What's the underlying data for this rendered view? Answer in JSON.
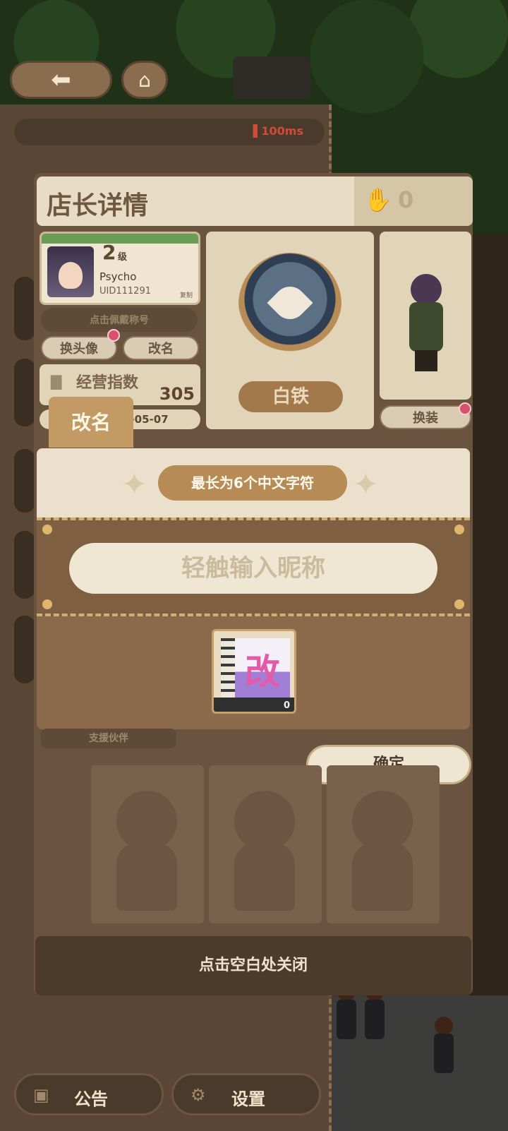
{
  "status": {
    "ping": "100ms"
  },
  "profile": {
    "title": "店长详情",
    "likes": "0",
    "level": "2",
    "level_label": "级",
    "name": "Psycho",
    "uid": "UID111291",
    "copy_label": "复制",
    "title_button": "点击佩戴称号",
    "change_avatar_button": "换头像",
    "rename_button": "改名",
    "score_label": "经营指数",
    "score_value": "305",
    "date_partial": "5-05-07",
    "rank": "白铁",
    "change_outfit_button": "换装",
    "support_label": "支援伙伴",
    "close_hint": "点击空白处关闭"
  },
  "dialog": {
    "tab_title": "改名",
    "hint": "最长为6个中文字符",
    "input_placeholder": "轻触输入昵称",
    "item_char": "改",
    "item_count": "0",
    "confirm_button": "确定"
  },
  "bottom": {
    "notice_button": "公告",
    "settings_button": "设置"
  },
  "colors": {
    "accent": "#b78b55",
    "panel": "#6b543f",
    "cream": "#ebe0cb",
    "badge": "#d9506a"
  },
  "icons": [
    "back-arrow-icon",
    "home-icon",
    "signal-icon",
    "thumbs-up-icon",
    "chart-icon",
    "medal-icon",
    "sparkle-icon",
    "rename-card-icon",
    "notice-icon",
    "gear-icon"
  ]
}
